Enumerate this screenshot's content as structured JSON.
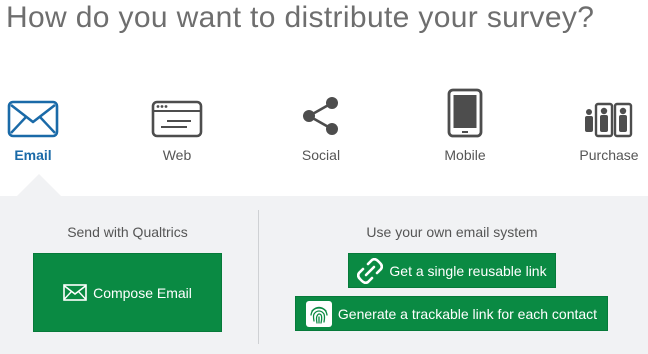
{
  "header": {
    "title": "How do you want to distribute your survey?"
  },
  "options": [
    {
      "label": "Email",
      "icon": "envelope-icon",
      "active": true
    },
    {
      "label": "Web",
      "icon": "browser-window-icon",
      "active": false
    },
    {
      "label": "Social",
      "icon": "share-icon",
      "active": false
    },
    {
      "label": "Mobile",
      "icon": "tablet-icon",
      "active": false
    },
    {
      "label": "Purchase",
      "icon": "people-icon",
      "active": false
    }
  ],
  "panel": {
    "left_heading": "Send with Qualtrics",
    "right_heading": "Use your own email system",
    "compose_button": "Compose Email",
    "reusable_link_button": "Get a single reusable link",
    "trackable_link_button": "Generate a trackable link for each contact"
  },
  "colors": {
    "accent_blue": "#1a6aa8",
    "button_green": "#0a8a43",
    "panel_bg": "#f1f2f4",
    "icon_gray": "#4d4d4d"
  }
}
